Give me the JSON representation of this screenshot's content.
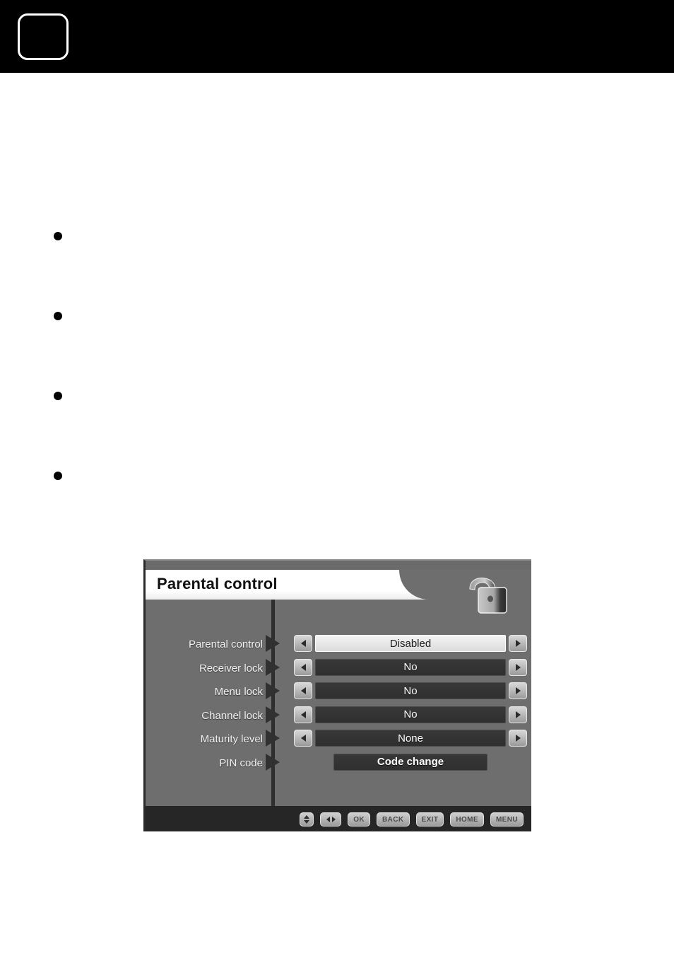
{
  "header": {
    "page_number": ""
  },
  "body": {
    "bullets": [
      "",
      "",
      "",
      ""
    ]
  },
  "osd": {
    "title": "Parental control",
    "lock_icon": "padlock-icon",
    "rows": [
      {
        "label": "Parental control",
        "value": "Disabled",
        "selected": true,
        "has_arrows": true
      },
      {
        "label": "Receiver lock",
        "value": "No",
        "selected": false,
        "has_arrows": true
      },
      {
        "label": "Menu lock",
        "value": "No",
        "selected": false,
        "has_arrows": true
      },
      {
        "label": "Channel lock",
        "value": "No",
        "selected": false,
        "has_arrows": true
      },
      {
        "label": "Maturity level",
        "value": "None",
        "selected": false,
        "has_arrows": true
      },
      {
        "label": "PIN code",
        "value": "Code change",
        "selected": false,
        "has_arrows": false
      }
    ],
    "keybar": [
      {
        "type": "updown",
        "label": ""
      },
      {
        "type": "leftright",
        "label": ""
      },
      {
        "type": "text",
        "label": "OK"
      },
      {
        "type": "text",
        "label": "BACK"
      },
      {
        "type": "text",
        "label": "EXIT"
      },
      {
        "type": "text",
        "label": "HOME"
      },
      {
        "type": "text",
        "label": "MENU"
      }
    ]
  },
  "colors": {
    "header_band": "#000000",
    "osd_background": "#6e6e6e",
    "osd_title_bar": "#ffffff",
    "value_box_normal": "#333333",
    "value_box_selected": "#e8e8e8",
    "bottom_bar": "#262626"
  }
}
